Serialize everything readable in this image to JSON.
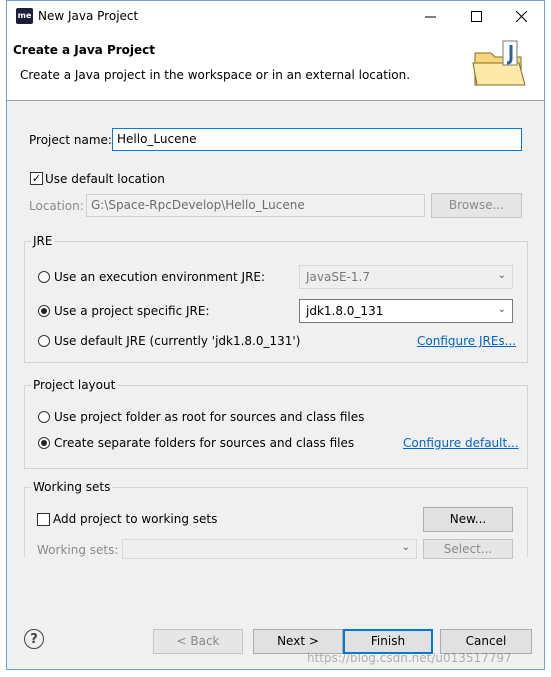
{
  "window": {
    "title": "New Java Project",
    "app_icon_label": "me"
  },
  "header": {
    "title": "Create a Java Project",
    "description": "Create a Java project in the workspace or in an external location."
  },
  "project": {
    "name_label": "Project name:",
    "name_value": "Hello_Lucene"
  },
  "location": {
    "use_default_label": "Use default location",
    "use_default_checked": true,
    "location_label": "Location:",
    "location_value": "G:\\Space-RpcDevelop\\Hello_Lucene",
    "browse_label": "Browse..."
  },
  "jre": {
    "group_title": "JRE",
    "exec_env_label": "Use an execution environment JRE:",
    "exec_env_value": "JavaSE-1.7",
    "project_specific_label": "Use a project specific JRE:",
    "project_specific_value": "jdk1.8.0_131",
    "default_label": "Use default JRE (currently 'jdk1.8.0_131')",
    "configure_link": "Configure JREs...",
    "selected": "project_specific"
  },
  "layout": {
    "group_title": "Project layout",
    "root_label": "Use project folder as root for sources and class files",
    "separate_label": "Create separate folders for sources and class files",
    "configure_link": "Configure default...",
    "selected": "separate"
  },
  "working_sets": {
    "group_title": "Working sets",
    "add_label": "Add project to working sets",
    "new_label": "New...",
    "sets_label": "Working sets:",
    "select_label": "Select..."
  },
  "footer": {
    "back_label": "< Back",
    "next_label": "Next >",
    "finish_label": "Finish",
    "cancel_label": "Cancel"
  },
  "watermark": "https://blog.csdn.net/u013517797"
}
